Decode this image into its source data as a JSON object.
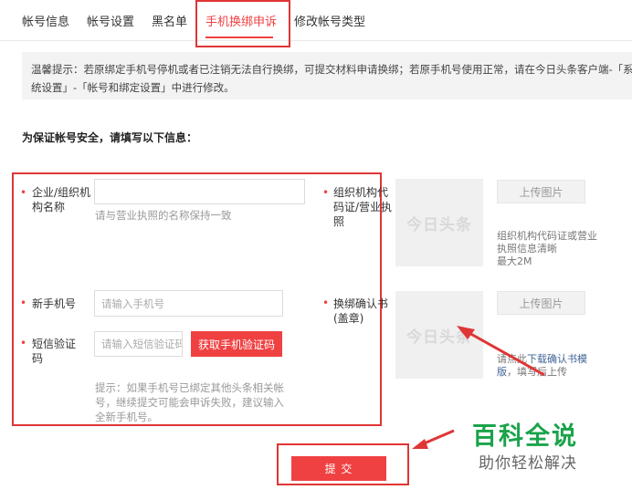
{
  "tabs": [
    {
      "label": "帐号信息"
    },
    {
      "label": "帐号设置"
    },
    {
      "label": "黑名单"
    },
    {
      "label": "手机换绑申诉",
      "active": true
    },
    {
      "label": "修改帐号类型"
    }
  ],
  "notice": {
    "line1": "温馨提示：若原绑定手机号停机或者已注销无法自行换绑，可提交材料申请换绑；若原手机号使用正常，请在今日头条客户端-「系",
    "line2": "统设置」-「帐号和绑定设置」中进行修改。"
  },
  "section_title": "为保证帐号安全，请填写以下信息：",
  "form": {
    "required_mark": "•",
    "org_name": {
      "label_line1": "企业/组织机",
      "label_line2": "构名称",
      "value": "",
      "hint": "请与营业执照的名称保持一致"
    },
    "new_phone": {
      "label": "新手机号",
      "placeholder": "请输入手机号"
    },
    "sms_code": {
      "label_line1": "短信验证",
      "label_line2": "码",
      "placeholder": "请输入短信验证码",
      "button": "获取手机验证码"
    },
    "tip_line1": "提示：如果手机号已绑定其他头条相关帐",
    "tip_line2": "号，继续提交可能会申诉失败，建议输入",
    "tip_line3": "全新手机号。"
  },
  "uploads": {
    "org_cert": {
      "label_line1": "组织机构代",
      "label_line2": "码证/营业执",
      "label_line3": "照",
      "placeholder_logo": "今日头条",
      "button": "上传图片",
      "hint_line1": "组织机构代码证或营业",
      "hint_line2": "执照信息清晰",
      "hint_line3": "最大2M"
    },
    "confirm_letter": {
      "label_line1": "换绑确认书",
      "label_line2": "(盖章)",
      "placeholder_logo": "今日头条",
      "button": "上传图片",
      "hint_prefix": "请点此",
      "hint_link": "下载确认书模",
      "hint_line2_link": "版",
      "hint_line2_rest": "，填写后上传"
    }
  },
  "submit_label": "提 交",
  "watermark": {
    "title": "百科全说",
    "subtitle": "助你轻松解决"
  },
  "colors": {
    "accent": "#f04142",
    "annotation": "#e03535",
    "watermark": "#1aa34a"
  }
}
